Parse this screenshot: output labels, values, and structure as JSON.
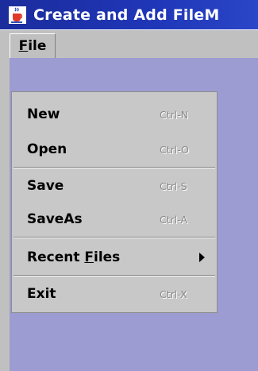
{
  "window": {
    "title": "Create and Add FileM"
  },
  "menubar": {
    "file_label": "File"
  },
  "file_menu": {
    "new": {
      "label": "New",
      "accelerator": "Ctrl-N"
    },
    "open": {
      "label": "Open",
      "accelerator": "Ctrl-O"
    },
    "save": {
      "label": "Save",
      "accelerator": "Ctrl-S"
    },
    "save_as": {
      "label": "SaveAs",
      "accelerator": "Ctrl-A"
    },
    "recent_files": {
      "label_before": "Recent ",
      "label_mnemonic": "F",
      "label_after": "iles"
    },
    "exit": {
      "label": "Exit",
      "accelerator": "Ctrl-X"
    }
  },
  "colors": {
    "titlebar": "#1f36b8",
    "client_area": "#9c9cd2",
    "menu_background": "#c8c8c8"
  },
  "icons": {
    "title": "java-coffee-cup-icon",
    "submenu": "submenu-arrow-icon"
  }
}
